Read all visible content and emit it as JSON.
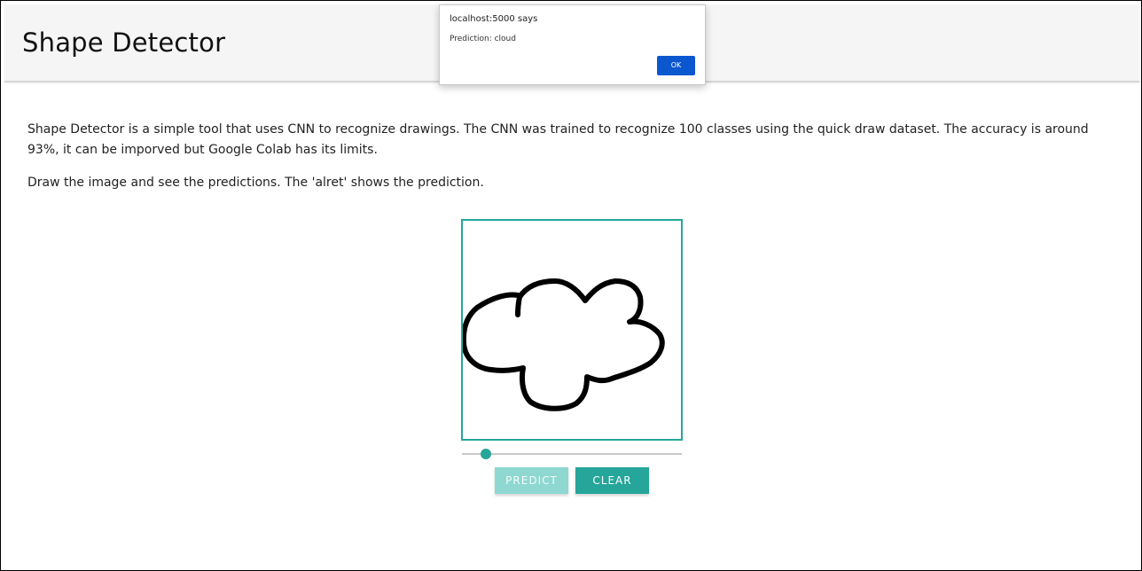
{
  "header": {
    "title": "Shape Detector"
  },
  "description": {
    "paragraph_1": "Shape Detector is a simple tool that uses CNN to recognize drawings. The CNN was trained to recognize 100 classes using the quick draw dataset. The accuracy is around 93%, it can be imporved but Google Colab has its limits.",
    "paragraph_2": "Draw the image and see the predictions. The 'alret' shows the prediction."
  },
  "canvas": {
    "border_color": "#26a69a",
    "stroke_color": "#000000",
    "drawing": "cloud"
  },
  "brush_slider": {
    "level_fraction": 0.11
  },
  "buttons": {
    "predict_label": "PREDICT",
    "clear_label": "CLEAR",
    "predict_color": "#8ed8d1",
    "clear_color": "#26a69a"
  },
  "alert": {
    "origin": "localhost:5000 says",
    "message": "Prediction: cloud",
    "ok_label": "OK",
    "ok_color": "#0b57d0"
  }
}
